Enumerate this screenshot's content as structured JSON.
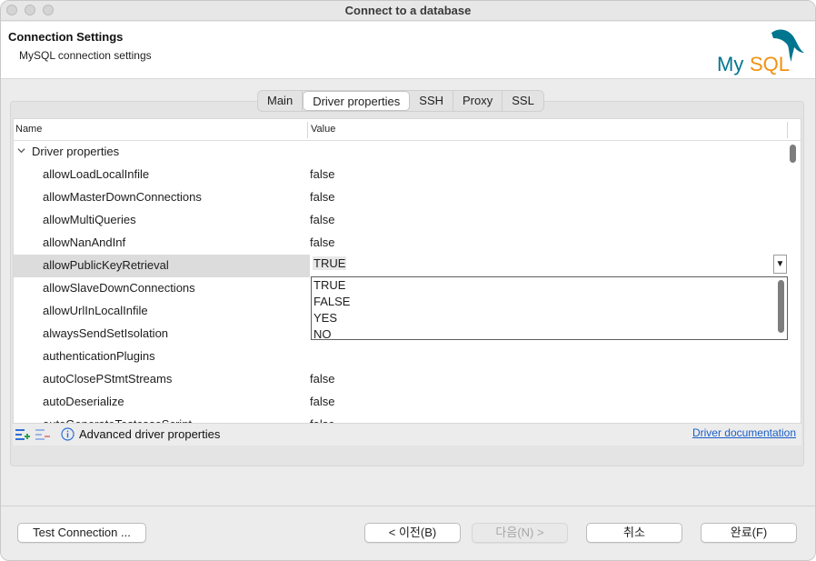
{
  "window": {
    "title": "Connect to a database"
  },
  "header": {
    "title": "Connection Settings",
    "subtitle": "MySQL connection settings",
    "logo_text": "MySQL"
  },
  "tabs": [
    {
      "label": "Main"
    },
    {
      "label": "Driver properties",
      "active": true
    },
    {
      "label": "SSH"
    },
    {
      "label": "Proxy"
    },
    {
      "label": "SSL"
    }
  ],
  "table": {
    "columns": {
      "name": "Name",
      "value": "Value"
    },
    "group": "Driver properties",
    "rows": [
      {
        "name": "allowLoadLocalInfile",
        "value": "false"
      },
      {
        "name": "allowMasterDownConnections",
        "value": "false"
      },
      {
        "name": "allowMultiQueries",
        "value": "false"
      },
      {
        "name": "allowNanAndInf",
        "value": "false"
      },
      {
        "name": "allowPublicKeyRetrieval",
        "value": "",
        "selected": true
      },
      {
        "name": "allowSlaveDownConnections",
        "value": ""
      },
      {
        "name": "allowUrlInLocalInfile",
        "value": ""
      },
      {
        "name": "alwaysSendSetIsolation",
        "value": ""
      },
      {
        "name": "authenticationPlugins",
        "value": ""
      },
      {
        "name": "autoClosePStmtStreams",
        "value": "false"
      },
      {
        "name": "autoDeserialize",
        "value": "false"
      },
      {
        "name": "autoGenerateTestcaseScript",
        "value": "false"
      }
    ]
  },
  "editor": {
    "current_value": "TRUE",
    "options": [
      "TRUE",
      "FALSE",
      "YES",
      "NO"
    ],
    "selected_option": "TRUE"
  },
  "footer": {
    "advanced_label": "Advanced driver properties",
    "doc_link": "Driver documentation"
  },
  "buttons": {
    "test_connection": "Test Connection ...",
    "back": "< 이전(B)",
    "next": "다음(N) >",
    "cancel": "취소",
    "finish": "완료(F)"
  },
  "colors": {
    "selection": "#3c6fd6",
    "link": "#1a5fc8",
    "mysql_blue": "#00758f",
    "mysql_orange": "#f29111"
  }
}
